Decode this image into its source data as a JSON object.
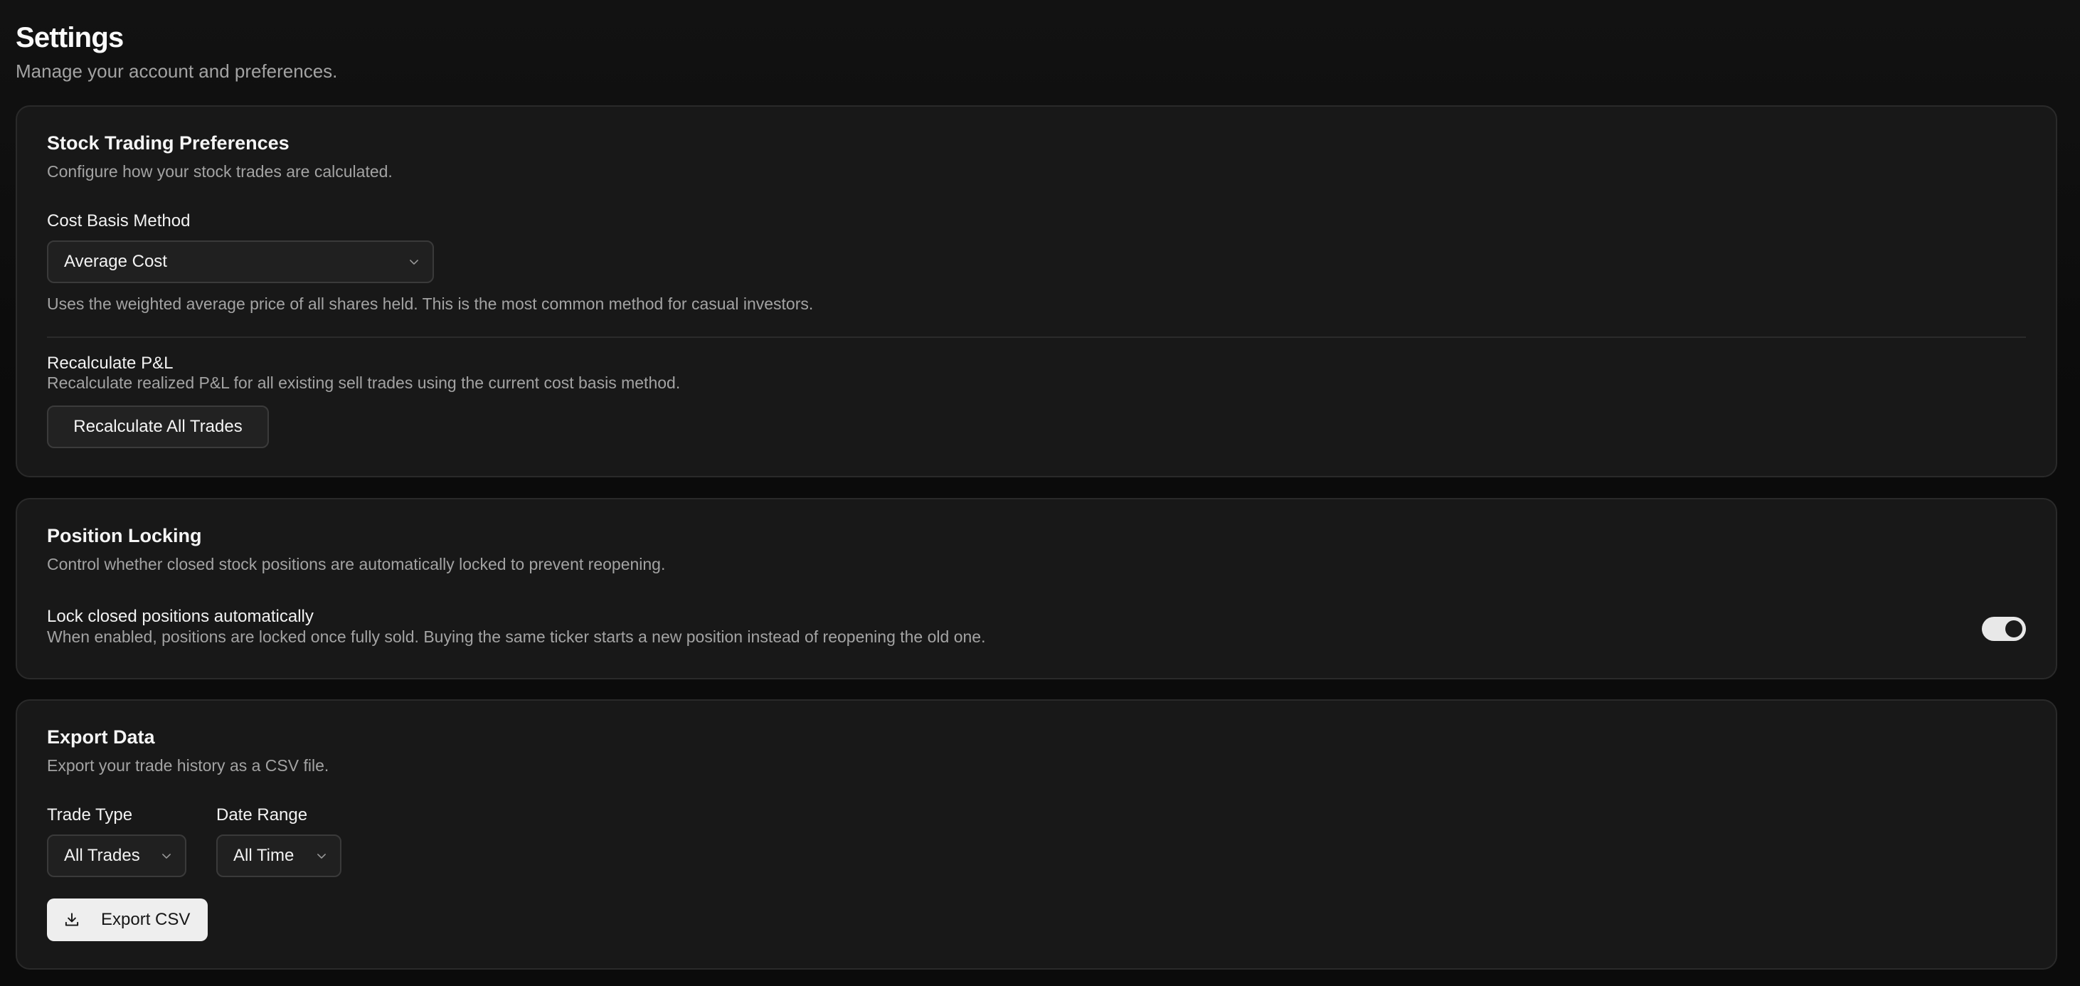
{
  "header": {
    "title": "Settings",
    "subtitle": "Manage your account and preferences."
  },
  "stock_prefs": {
    "title": "Stock Trading Preferences",
    "description": "Configure how your stock trades are calculated.",
    "cost_basis": {
      "label": "Cost Basis Method",
      "value": "Average Cost",
      "help": "Uses the weighted average price of all shares held. This is the most common method for casual investors."
    },
    "recalculate": {
      "label": "Recalculate P&L",
      "description": "Recalculate realized P&L for all existing sell trades using the current cost basis method.",
      "button_label": "Recalculate All Trades"
    }
  },
  "position_locking": {
    "title": "Position Locking",
    "description": "Control whether closed stock positions are automatically locked to prevent reopening.",
    "lock_setting": {
      "label": "Lock closed positions automatically",
      "description": "When enabled, positions are locked once fully sold. Buying the same ticker starts a new position instead of reopening the old one.",
      "enabled": true
    }
  },
  "export": {
    "title": "Export Data",
    "description": "Export your trade history as a CSV file.",
    "trade_type": {
      "label": "Trade Type",
      "value": "All Trades"
    },
    "date_range": {
      "label": "Date Range",
      "value": "All Time"
    },
    "button_label": "Export CSV",
    "button_icon": "download-icon"
  },
  "colors": {
    "background": "#0b0b0b",
    "card": "#181818",
    "border": "#2a2a2a",
    "primary_button": "#eeeeee",
    "muted_text": "#a3a3a3"
  }
}
